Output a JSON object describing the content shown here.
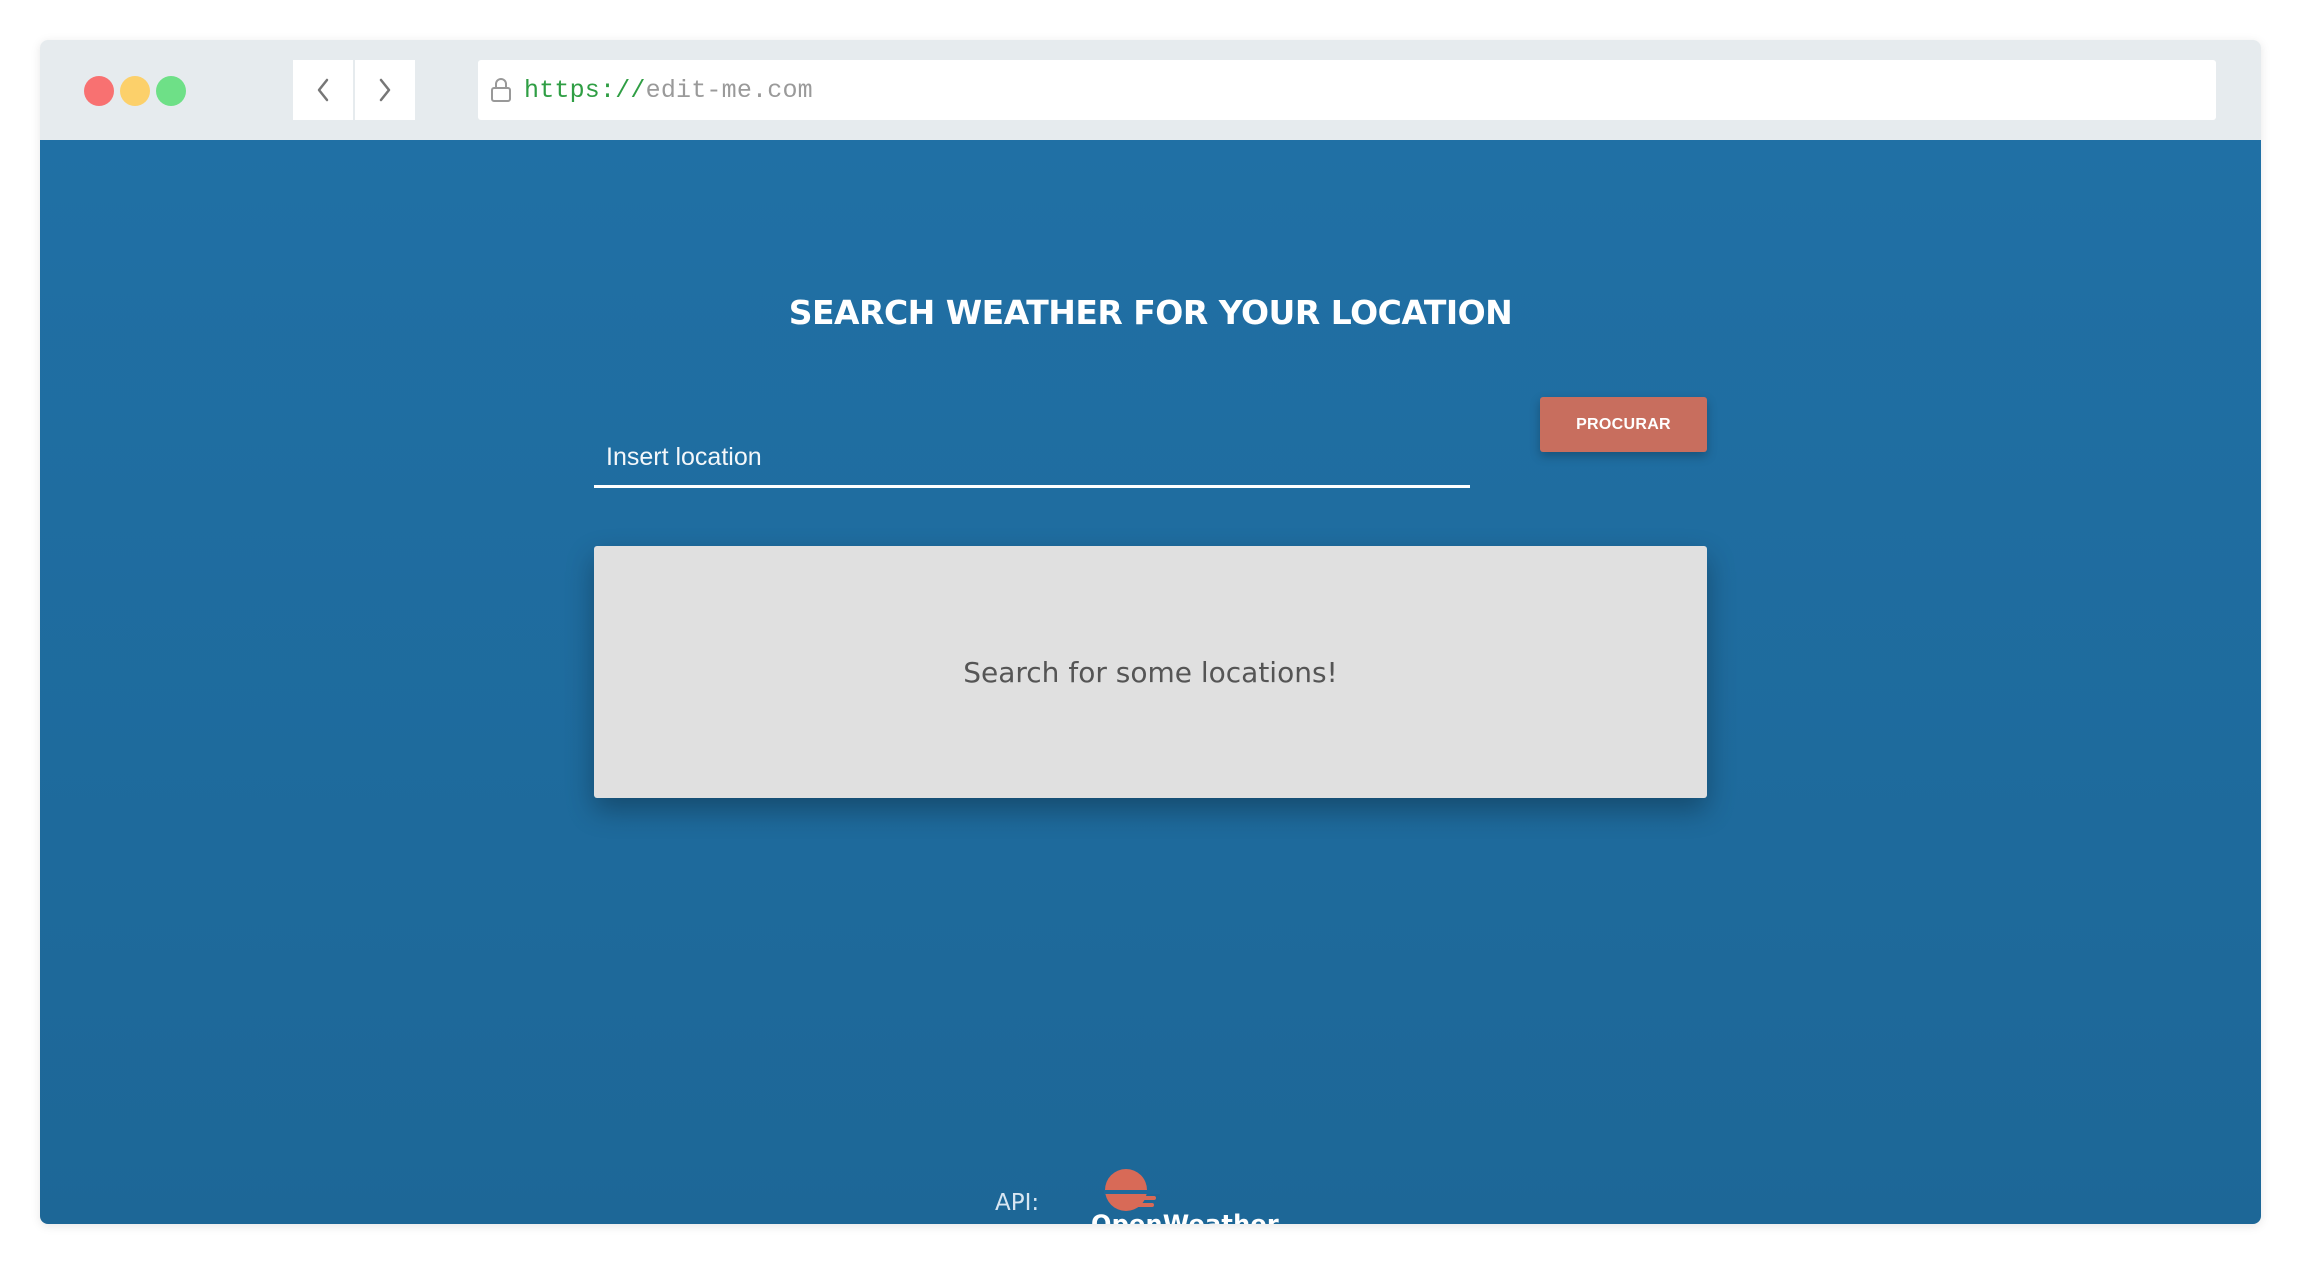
{
  "browser": {
    "url_scheme": "https://",
    "url_host": "edit-me.com",
    "colors": {
      "close": "#f87171",
      "minimize": "#fcd06a",
      "maximize": "#6ee087"
    }
  },
  "main": {
    "title": "SEARCH WEATHER FOR YOUR LOCATION",
    "search": {
      "placeholder": "Insert location",
      "value": "",
      "button_label": "PROCURAR"
    },
    "result_message": "Search for some locations!"
  },
  "footer": {
    "api_label": "API:",
    "logo_text": "OpenWeather"
  },
  "theme": {
    "background": "#2070a5",
    "accent": "#c86e5e",
    "card": "#e0e0e0"
  }
}
